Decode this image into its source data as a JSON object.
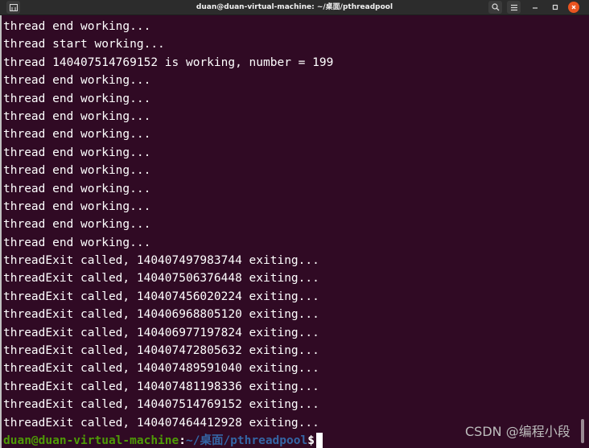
{
  "window": {
    "title": "duan@duan-virtual-machine: ~/桌面/pthreadpool",
    "icons": {
      "new_tab": "terminal-tab-icon",
      "search": "search-icon",
      "menu": "hamburger-menu-icon",
      "minimize": "minimize-icon",
      "maximize": "maximize-icon",
      "close": "close-icon"
    },
    "colors": {
      "terminal_bg": "#300a24",
      "titlebar_bg": "#2c2c2c",
      "close_button": "#e95420",
      "prompt_user": "#4e9a06",
      "prompt_path": "#3465a4"
    }
  },
  "terminal": {
    "lines": [
      "thread end working...",
      "thread start working...",
      "thread 140407514769152 is working, number = 199",
      "thread end working...",
      "thread end working...",
      "thread end working...",
      "thread end working...",
      "thread end working...",
      "thread end working...",
      "thread end working...",
      "thread end working...",
      "thread end working...",
      "thread end working...",
      "threadExit called, 140407497983744 exiting...",
      "threadExit called, 140407506376448 exiting...",
      "threadExit called, 140407456020224 exiting...",
      "threadExit called, 140406968805120 exiting...",
      "threadExit called, 140406977197824 exiting...",
      "threadExit called, 140407472805632 exiting...",
      "threadExit called, 140407489591040 exiting...",
      "threadExit called, 140407481198336 exiting...",
      "threadExit called, 140407514769152 exiting...",
      "threadExit called, 140407464412928 exiting..."
    ],
    "prompt": {
      "user_host": "duan@duan-virtual-machine",
      "colon": ":",
      "path": "~/桌面/pthreadpool",
      "symbol": "$"
    }
  },
  "watermark": "CSDN @编程小段"
}
